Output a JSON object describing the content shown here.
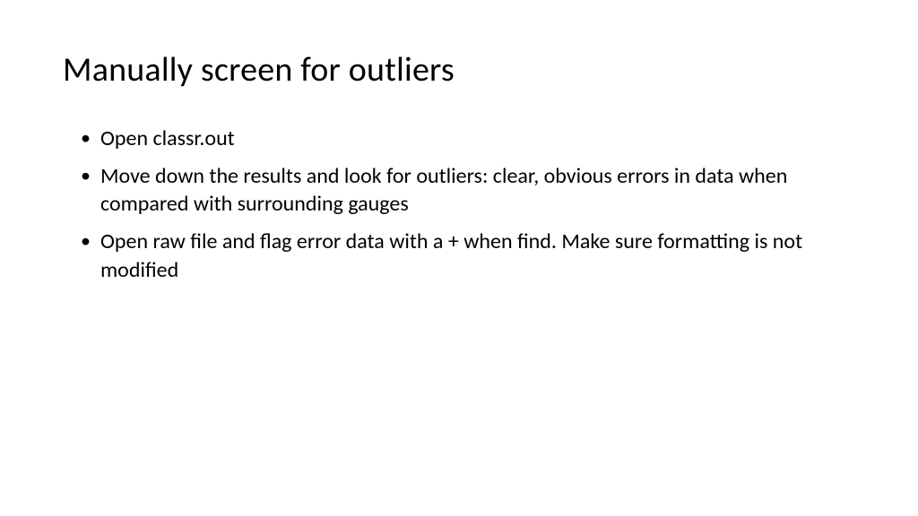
{
  "slide": {
    "title": "Manually screen for outliers",
    "bullets": [
      "Open classr.out",
      "Move down the results and look for outliers: clear, obvious errors in data when compared with surrounding gauges",
      "Open raw file and flag error data with a + when find. Make sure formatting is not modified"
    ]
  }
}
